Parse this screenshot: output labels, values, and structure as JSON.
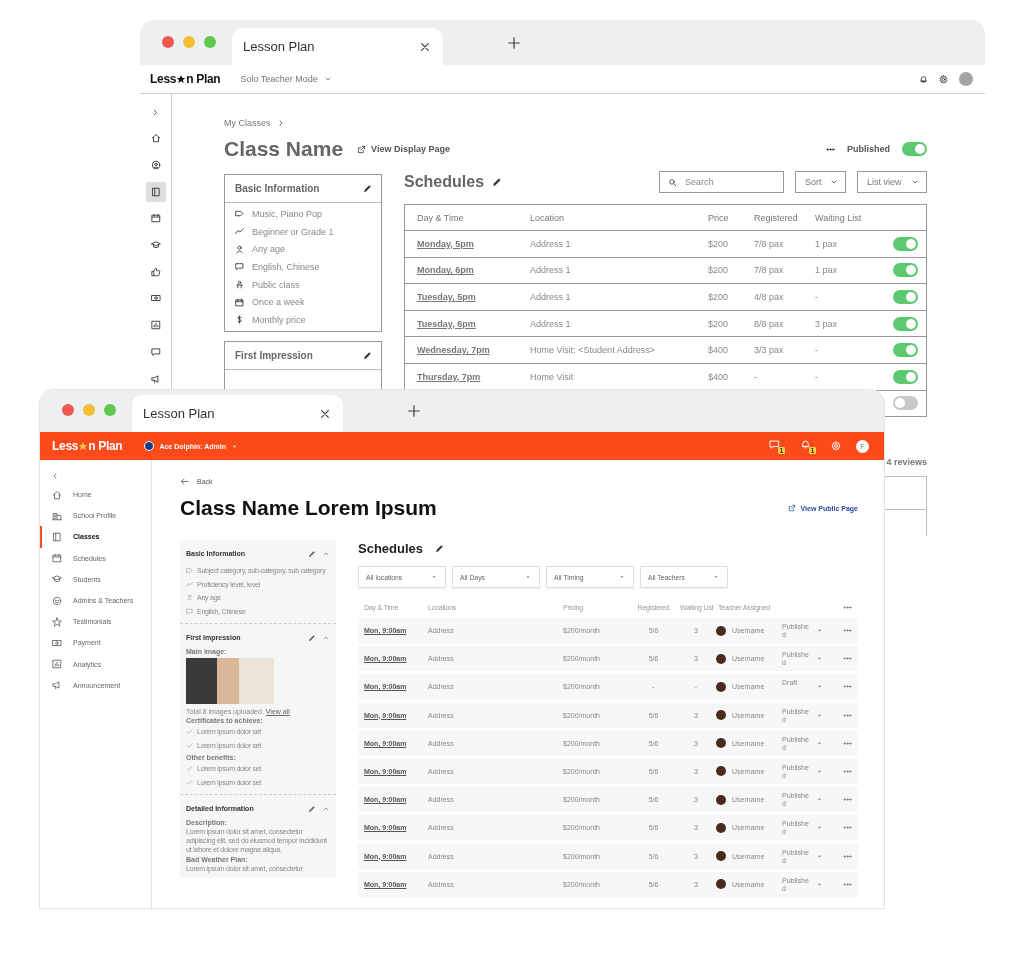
{
  "back_window": {
    "tab": {
      "title": "Lesson Plan"
    },
    "logo": {
      "before": "Less",
      "after": "n Plan"
    },
    "mode_menu": "Solo Teacher Mode",
    "sidebar": [
      {
        "selected": false
      },
      {
        "selected": false
      },
      {
        "selected": true
      },
      {
        "selected": false
      },
      {
        "selected": false
      },
      {
        "selected": false
      },
      {
        "selected": false
      },
      {
        "selected": false
      },
      {
        "selected": false
      },
      {
        "selected": false
      }
    ],
    "breadcrumb": "My Classes",
    "title": "Class Name",
    "view_link": "View Display Page",
    "published": {
      "label": "Published",
      "on": true
    },
    "basic_info": {
      "title": "Basic Information",
      "items": [
        "Music, Piano Pop",
        "Beginner or Grade 1",
        "Any age",
        "English, Chinese",
        "Public class",
        "Once a week",
        "Monthly price"
      ]
    },
    "first_impression": {
      "title": "First Impression"
    },
    "schedules": {
      "title": "Schedules",
      "search_placeholder": "Search",
      "sort": "Sort",
      "view": "List view",
      "columns": [
        "Day & Time",
        "Location",
        "Price",
        "Registered",
        "Waiting List"
      ],
      "rows": [
        {
          "day": "Monday, 5pm",
          "location": "Address 1",
          "price": "$200",
          "registered": "7/8 pax",
          "waiting": "1 pax",
          "on": true
        },
        {
          "day": "Monday, 6pm",
          "location": "Address 1",
          "price": "$200",
          "registered": "7/8 pax",
          "waiting": "1 pax",
          "on": true
        },
        {
          "day": "Tuesday, 5pm",
          "location": "Address 1",
          "price": "$200",
          "registered": "4/8 pax",
          "waiting": "-",
          "on": true
        },
        {
          "day": "Tuesday, 6pm",
          "location": "Address 1",
          "price": "$200",
          "registered": "8/8 pax",
          "waiting": "3 pax",
          "on": true
        },
        {
          "day": "Wednesday, 7pm",
          "location": "Home Visit: <Student Address>",
          "price": "$400",
          "registered": "3/3 pax",
          "waiting": "-",
          "on": true
        },
        {
          "day": "Thursday, 7pm",
          "location": "Home Visit",
          "price": "$400",
          "registered": "-",
          "waiting": "-",
          "on": true
        },
        {
          "on": false
        }
      ]
    },
    "reviews": "4 reviews"
  },
  "front_window": {
    "tab": {
      "title": "Lesson Plan"
    },
    "logo": {
      "before": "Less",
      "after": "n Plan"
    },
    "account": "Ace Dolphin: Admin",
    "notification_badges": [
      "1",
      "1"
    ],
    "avatar": "F",
    "sidebar": [
      {
        "label": "Home",
        "selected": false
      },
      {
        "label": "School Profile",
        "selected": false
      },
      {
        "label": "Classes",
        "selected": true
      },
      {
        "label": "Schedules",
        "selected": false
      },
      {
        "label": "Students",
        "selected": false
      },
      {
        "label": "Admins & Teachers",
        "selected": false
      },
      {
        "label": "Testimonials",
        "selected": false
      },
      {
        "label": "Payment",
        "selected": false
      },
      {
        "label": "Analytics",
        "selected": false
      },
      {
        "label": "Announcement",
        "selected": false
      }
    ],
    "back": "Back",
    "title": "Class Name Lorem Ipsum",
    "public_link": "View Public Page",
    "basic_info": {
      "title": "Basic Information",
      "items": [
        "Subject category, sub-category, sub category",
        "Proficiency level, level",
        "Any age",
        "English, Chinese"
      ]
    },
    "first_impression": {
      "title": "First Impression",
      "main_image_label": "Main image:",
      "images_note": "Total 8 images uploaded.",
      "view_all": "View all",
      "groups": [
        {
          "title": "Certificates to achieve:",
          "items": [
            "Lorem ipsum dolor set",
            "Lorem ipsum dolor set"
          ]
        },
        {
          "title": "Other benefits:",
          "items": [
            "Lorem ipsum dolor set",
            "Lorem ipsum dolor set"
          ]
        }
      ]
    },
    "detailed_info": {
      "title": "Detailed Information",
      "blocks": [
        {
          "label": "Description:",
          "text": "Lorem ipsum dolor sit amet, consectetur adipiscing elit, sed do eiusmod tempor incididunt ut labore et dolore magna aliqua."
        },
        {
          "label": "Bad Weather Plan:",
          "text": "Lorem ipsum dolor sit amet, consectetur"
        }
      ]
    },
    "schedules": {
      "title": "Schedules",
      "filters": [
        "All locations",
        "All Days",
        "All Timing",
        "All Teachers"
      ],
      "columns": [
        "Day & Time",
        "Locations",
        "Pricing",
        "Registered",
        "Waiting List",
        "Teacher Assigned"
      ],
      "rows": [
        {
          "day": "Mon, 9:00am",
          "location": "Address",
          "pricing": "$200/month",
          "registered": "5/6",
          "waiting": "3",
          "teacher": "Username",
          "status": "Published"
        },
        {
          "day": "Mon, 9:00am",
          "location": "Address",
          "pricing": "$200/month",
          "registered": "5/6",
          "waiting": "3",
          "teacher": "Username",
          "status": "Published"
        },
        {
          "day": "Mon, 9:00am",
          "location": "Address",
          "pricing": "$200/month",
          "registered": "-",
          "waiting": "-",
          "teacher": "Username",
          "status": "Draft"
        },
        {
          "day": "Mon, 9:00am",
          "location": "Address",
          "pricing": "$200/month",
          "registered": "5/6",
          "waiting": "3",
          "teacher": "Username",
          "status": "Published"
        },
        {
          "day": "Mon, 9:00am",
          "location": "Address",
          "pricing": "$200/month",
          "registered": "5/6",
          "waiting": "3",
          "teacher": "Username",
          "status": "Published"
        },
        {
          "day": "Mon, 9:00am",
          "location": "Address",
          "pricing": "$200/month",
          "registered": "5/6",
          "waiting": "3",
          "teacher": "Username",
          "status": "Published"
        },
        {
          "day": "Mon, 9:00am",
          "location": "Address",
          "pricing": "$200/month",
          "registered": "5/6",
          "waiting": "3",
          "teacher": "Username",
          "status": "Published"
        },
        {
          "day": "Mon, 9:00am",
          "location": "Address",
          "pricing": "$200/month",
          "registered": "5/6",
          "waiting": "3",
          "teacher": "Username",
          "status": "Published"
        },
        {
          "day": "Mon, 9:00am",
          "location": "Address",
          "pricing": "$200/month",
          "registered": "5/6",
          "waiting": "3",
          "teacher": "Username",
          "status": "Published"
        },
        {
          "day": "Mon, 9:00am",
          "location": "Address",
          "pricing": "$200/month",
          "registered": "5/6",
          "waiting": "3",
          "teacher": "Username",
          "status": "Published"
        }
      ]
    }
  }
}
